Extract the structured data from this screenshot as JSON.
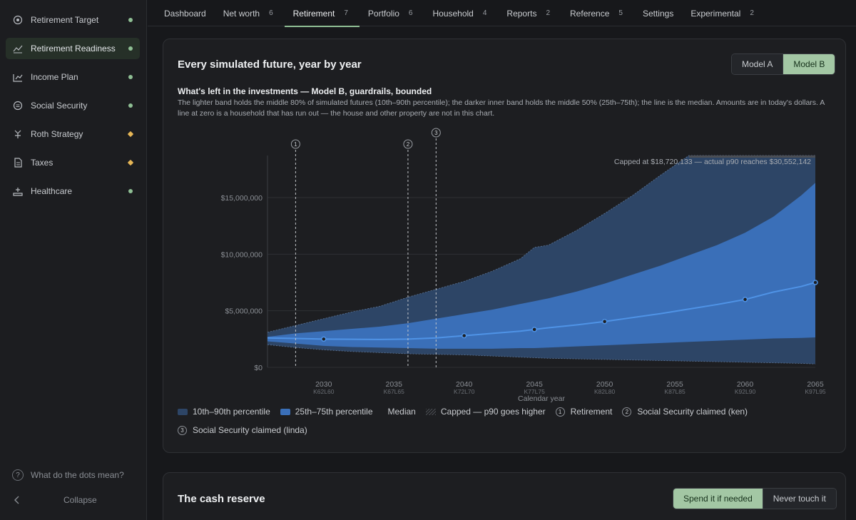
{
  "sidebar": {
    "items": [
      {
        "label": "Retirement Target",
        "icon": "target-icon",
        "status": "ok"
      },
      {
        "label": "Retirement Readiness",
        "icon": "trend-icon",
        "status": "ok",
        "active": true
      },
      {
        "label": "Income Plan",
        "icon": "chart-icon",
        "status": "ok"
      },
      {
        "label": "Social Security",
        "icon": "dollar-icon",
        "status": "ok"
      },
      {
        "label": "Roth Strategy",
        "icon": "fork-icon",
        "status": "warn"
      },
      {
        "label": "Taxes",
        "icon": "document-icon",
        "status": "warn"
      },
      {
        "label": "Healthcare",
        "icon": "care-icon",
        "status": "ok"
      }
    ],
    "help": "What do the dots mean?",
    "collapse": "Collapse"
  },
  "tabs": [
    {
      "label": "Dashboard",
      "count": ""
    },
    {
      "label": "Net worth",
      "count": "6"
    },
    {
      "label": "Retirement",
      "count": "7",
      "active": true
    },
    {
      "label": "Portfolio",
      "count": "6"
    },
    {
      "label": "Household",
      "count": "4"
    },
    {
      "label": "Reports",
      "count": "2"
    },
    {
      "label": "Reference",
      "count": "5"
    },
    {
      "label": "Settings",
      "count": ""
    },
    {
      "label": "Experimental",
      "count": "2"
    }
  ],
  "card1": {
    "title": "Every simulated future, year by year",
    "models": [
      "Model A",
      "Model B"
    ],
    "selected_model": "Model B",
    "heading": "What's left in the investments — Model B, guardrails, bounded",
    "description": "The lighter band holds the middle 80% of simulated futures (10th–90th percentile); the darker inner band holds the middle 50% (25th–75th); the line is the median. Amounts are in today's dollars. A line at zero is a household that has run out — the house and other property are not in this chart."
  },
  "card2": {
    "title": "The cash reserve",
    "options": [
      "Spend it if needed",
      "Never touch it"
    ],
    "selected": "Spend it if needed"
  },
  "colors": {
    "outer": "#2d4566",
    "inner": "#3a6fb8",
    "median": "#4f93e6",
    "accent": "#8fbf94",
    "warn": "#e6b656"
  },
  "chart_data": {
    "type": "area",
    "xlabel": "Calendar year",
    "ylabel": "",
    "x_ticks": [
      {
        "year": 2030,
        "sub": "K62L60"
      },
      {
        "year": 2035,
        "sub": "K67L65"
      },
      {
        "year": 2040,
        "sub": "K72L70"
      },
      {
        "year": 2045,
        "sub": "K77L75"
      },
      {
        "year": 2050,
        "sub": "K82L80"
      },
      {
        "year": 2055,
        "sub": "K87L85"
      },
      {
        "year": 2060,
        "sub": "K92L90"
      },
      {
        "year": 2065,
        "sub": "K97L95"
      }
    ],
    "y_ticks": [
      {
        "value": 0,
        "label": "$0"
      },
      {
        "value": 5000000,
        "label": "$5,000,000"
      },
      {
        "value": 10000000,
        "label": "$10,000,000"
      },
      {
        "value": 15000000,
        "label": "$15,000,000"
      }
    ],
    "xlim": [
      2026,
      2065
    ],
    "ylim": [
      0,
      18720133
    ],
    "cap_note": "Capped at $18,720,133 — actual p90 reaches $30,552,142",
    "x": [
      2026,
      2028,
      2030,
      2032,
      2034,
      2036,
      2038,
      2040,
      2042,
      2044,
      2045,
      2046,
      2048,
      2050,
      2052,
      2054,
      2056,
      2058,
      2060,
      2062,
      2064,
      2065
    ],
    "series": [
      {
        "name": "10th–90th percentile",
        "role": "p10",
        "values": [
          2000000,
          1750000,
          1550000,
          1400000,
          1300000,
          1200000,
          1150000,
          1100000,
          1000000,
          900000,
          850000,
          800000,
          750000,
          700000,
          650000,
          600000,
          550000,
          500000,
          450000,
          400000,
          350000,
          300000
        ]
      },
      {
        "name": "10th–90th percentile",
        "role": "p90",
        "values": [
          3100000,
          3700000,
          4300000,
          4900000,
          5400000,
          6200000,
          6900000,
          7600000,
          8500000,
          9600000,
          10600000,
          10800000,
          12100000,
          13600000,
          15200000,
          17000000,
          18720133,
          18720133,
          18720133,
          18720133,
          18720133,
          18720133
        ]
      },
      {
        "name": "25th–75th percentile",
        "role": "p25",
        "values": [
          2300000,
          2100000,
          1900000,
          1800000,
          1750000,
          1700000,
          1650000,
          1650000,
          1650000,
          1700000,
          1700000,
          1750000,
          1850000,
          1950000,
          2050000,
          2150000,
          2250000,
          2350000,
          2450000,
          2550000,
          2600000,
          2650000
        ]
      },
      {
        "name": "25th–75th percentile",
        "role": "p75",
        "values": [
          2700000,
          3000000,
          3200000,
          3400000,
          3600000,
          3900000,
          4300000,
          4700000,
          5100000,
          5600000,
          5850000,
          6100000,
          6700000,
          7400000,
          8200000,
          9000000,
          9900000,
          10800000,
          11900000,
          13300000,
          15200000,
          16300000
        ]
      },
      {
        "name": "Median",
        "role": "median",
        "values": [
          2600000,
          2550000,
          2500000,
          2480000,
          2470000,
          2500000,
          2600000,
          2800000,
          3000000,
          3200000,
          3350000,
          3500000,
          3750000,
          4050000,
          4400000,
          4750000,
          5150000,
          5550000,
          6000000,
          6650000,
          7150000,
          7500000
        ]
      }
    ],
    "markers": [
      {
        "id": "1",
        "year": 2028,
        "label": "Retirement"
      },
      {
        "id": "2",
        "year": 2036,
        "label": "Social Security claimed (ken)"
      },
      {
        "id": "3",
        "year": 2038,
        "label": "Social Security claimed (linda)"
      }
    ],
    "legend": [
      {
        "label": "10th–90th percentile",
        "kind": "outer"
      },
      {
        "label": "25th–75th percentile",
        "kind": "inner"
      },
      {
        "label": "Median",
        "kind": "median"
      },
      {
        "label": "Capped — p90 goes higher",
        "kind": "cap"
      }
    ]
  }
}
